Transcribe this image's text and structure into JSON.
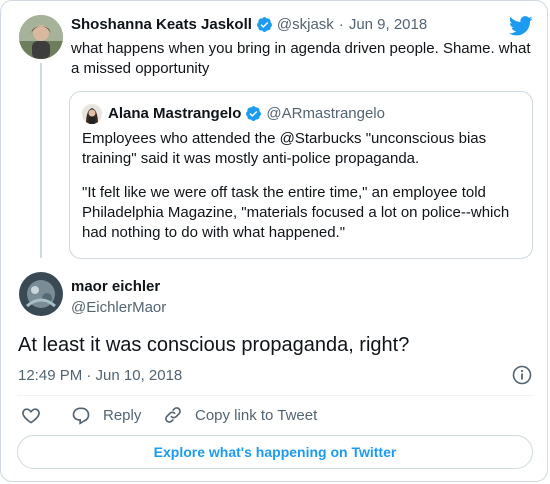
{
  "original_tweet": {
    "author_name": "Shoshanna Keats Jaskoll",
    "handle": "@skjask",
    "separator": "·",
    "date": "Jun 9, 2018",
    "text": "what happens when you bring in agenda driven people. Shame. what a missed opportunity"
  },
  "quoted_tweet": {
    "author_name": "Alana Mastrangelo",
    "handle": "@ARmastrangelo",
    "paragraph_1": "Employees who attended the @Starbucks \"unconscious bias training\" said it was mostly anti-police propaganda.",
    "paragraph_2": "\"It felt like we were off task the entire time,\" an employee told Philadelphia Magazine, \"materials focused a lot on police--which had nothing to do with what happened.\""
  },
  "reply_tweet": {
    "author_name": "maor eichler",
    "handle": "@EichlerMaor",
    "text": "At least it was conscious propaganda, right?",
    "timestamp": "12:49 PM · Jun 10, 2018"
  },
  "actions": {
    "reply_label": "Reply",
    "copy_link_label": "Copy link to Tweet"
  },
  "footer": {
    "explore_label": "Explore what's happening on Twitter"
  },
  "colors": {
    "brand_blue": "#1d9bf0",
    "text": "#0f1419",
    "muted": "#536471",
    "border": "#cfd9de"
  },
  "icons": [
    "twitter-logo-icon",
    "verified-badge-icon",
    "info-icon",
    "heart-icon",
    "reply-icon",
    "link-icon"
  ]
}
